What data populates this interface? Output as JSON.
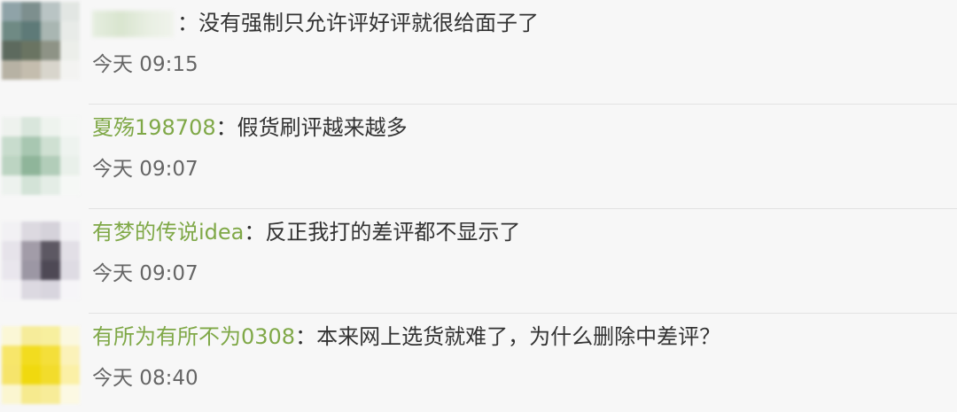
{
  "comments": [
    {
      "username": "",
      "separator": "：",
      "text": "没有强制只允许评好评就很给面子了",
      "time": "今天 09:15",
      "avatar_colors": [
        "#8fa3a8",
        "#7d8f8e",
        "#b9c4c4",
        "#e2e6e3",
        "#6f8a84",
        "#5e7a78",
        "#a9b6b2",
        "#e8ebe8",
        "#5d6a5e",
        "#6a7462",
        "#8e9386",
        "#eceeea",
        "#b7b2a4",
        "#c4bdae",
        "#d8d5cc",
        "#f3f3f1"
      ]
    },
    {
      "username": "夏殇198708",
      "separator": "：",
      "text": "假货刷评越来越多",
      "time": "今天 09:07",
      "avatar_colors": [
        "#eef2ee",
        "#d9e6dc",
        "#eef3ee",
        "#f5f7f5",
        "#c8dccd",
        "#a8c7b1",
        "#cfe0d2",
        "#eef3ef",
        "#bcd4c2",
        "#8fb59a",
        "#b2cdb9",
        "#e9f0ea",
        "#edf2ee",
        "#d3e3d7",
        "#e4ede6",
        "#f6f8f6"
      ]
    },
    {
      "username": "有梦的传说idea",
      "separator": "：",
      "text": "反正我打的差评都不显示了",
      "time": "今天 09:07",
      "avatar_colors": [
        "#f2f1f4",
        "#dcd9e0",
        "#d5d2da",
        "#f3f2f5",
        "#e6e3ea",
        "#a29ca8",
        "#5d5863",
        "#e2dfe6",
        "#e9e6ed",
        "#9c97a4",
        "#4e4955",
        "#dedbe3",
        "#f5f4f7",
        "#dcd9e1",
        "#d8d5de",
        "#f6f5f8"
      ]
    },
    {
      "username": "有所为有所不为0308",
      "separator": "：",
      "text": "本来网上选货就难了，为什么删除中差评？",
      "time": "今天 08:40",
      "avatar_colors": [
        "#fbf7d6",
        "#f6ec9a",
        "#f7ef9e",
        "#fbf8e0",
        "#f7e66a",
        "#f2dc1f",
        "#f4df3a",
        "#fbf2b9",
        "#f6e46b",
        "#f0d90f",
        "#f2dc2c",
        "#fbf0a6",
        "#fbf6d0",
        "#f6ea8e",
        "#f7ec98",
        "#fcf9e3"
      ]
    }
  ]
}
